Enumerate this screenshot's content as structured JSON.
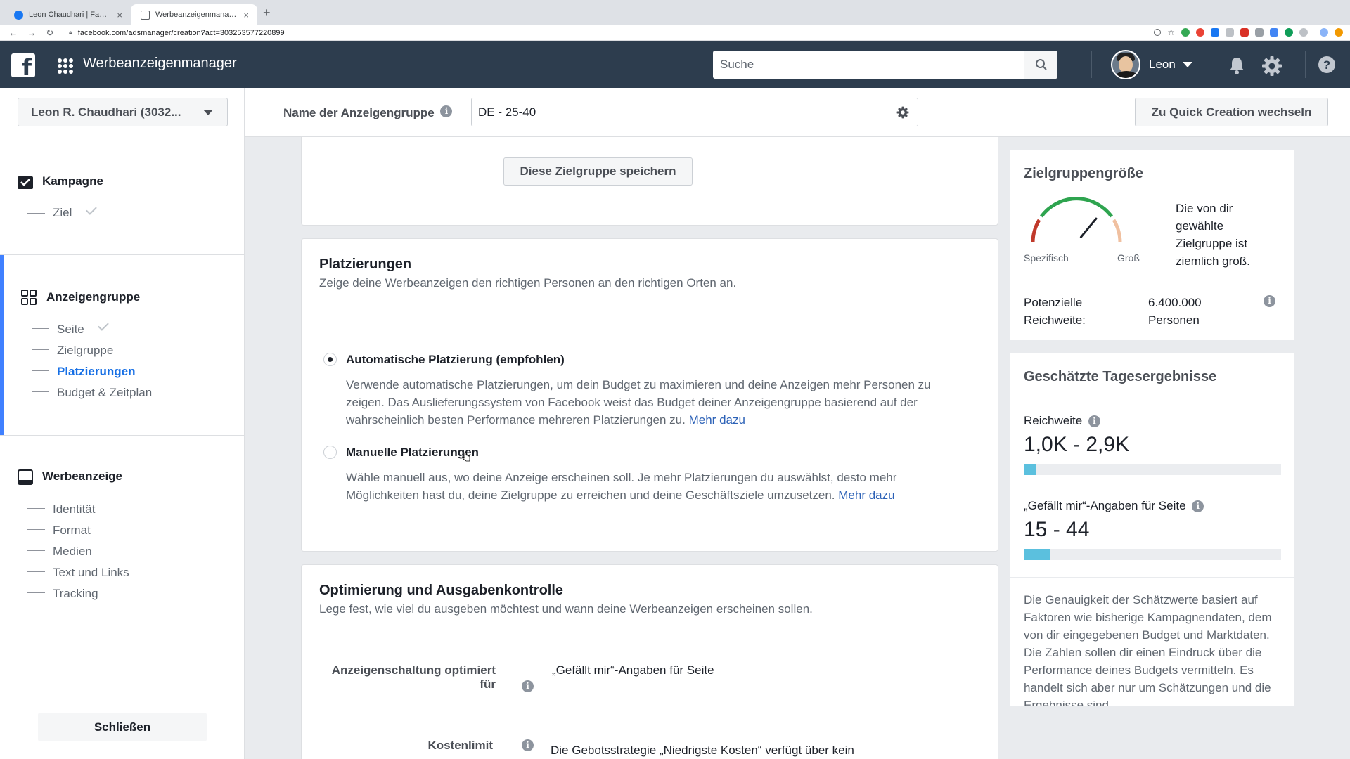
{
  "browser": {
    "tabs": [
      {
        "title": "Leon Chaudhari | Facebook",
        "active": false
      },
      {
        "title": "Werbeanzeigenmanager - Cre...",
        "active": true
      }
    ],
    "url": "facebook.com/adsmanager/creation?act=303253577220899"
  },
  "topbar": {
    "app_title": "Werbeanzeigenmanager",
    "search_placeholder": "Suche",
    "user_name": "Leon"
  },
  "header": {
    "account": "Leon R. Chaudhari (3032...",
    "adset_label": "Name der Anzeigengruppe",
    "adset_value": "DE - 25-40",
    "quick_btn": "Zu Quick Creation wechseln"
  },
  "sidebar": {
    "campaign": {
      "title": "Kampagne",
      "items": [
        "Ziel"
      ]
    },
    "adset": {
      "title": "Anzeigengruppe",
      "items": [
        "Seite",
        "Zielgruppe",
        "Platzierungen",
        "Budget & Zeitplan"
      ]
    },
    "ad": {
      "title": "Werbeanzeige",
      "items": [
        "Identität",
        "Format",
        "Medien",
        "Text und Links",
        "Tracking"
      ]
    },
    "close": "Schließen"
  },
  "audience_card": {
    "save_btn": "Diese Zielgruppe speichern"
  },
  "placements": {
    "title": "Platzierungen",
    "subtitle": "Zeige deine Werbeanzeigen den richtigen Personen an den richtigen Orten an.",
    "auto": {
      "label": "Automatische Platzierung (empfohlen)",
      "desc_l1": "Verwende automatische Platzierungen, um dein Budget zu maximieren und deine Anzeigen mehr Personen zu",
      "desc_l2": "zeigen. Das Auslieferungssystem von Facebook weist das Budget deiner Anzeigengruppe basierend auf der",
      "desc_l3": "wahrscheinlich besten Performance mehreren Platzierungen zu.",
      "link": "Mehr dazu",
      "selected": true
    },
    "manual": {
      "label": "Manuelle Platzierungen",
      "desc_l1": "Wähle manuell aus, wo deine Anzeige erscheinen soll. Je mehr Platzierungen du auswählst, desto mehr",
      "desc_l2": "Möglichkeiten hast du, deine Zielgruppe zu erreichen und deine Geschäftsziele umzusetzen.",
      "link": "Mehr dazu",
      "selected": false
    }
  },
  "optimization": {
    "title": "Optimierung und Ausgabenkontrolle",
    "subtitle": "Lege fest, wie viel du ausgeben möchtest und wann deine Werbeanzeigen erscheinen sollen.",
    "opt_label": "Anzeigenschaltung optimiert für",
    "opt_value": "„Gefällt mir“-Angaben für Seite",
    "cost_label": "Kostenlimit",
    "cost_value": "Die Gebotsstrategie „Niedrigste Kosten“ verfügt über kein"
  },
  "audience_size": {
    "title": "Zielgruppengröße",
    "specific": "Spezifisch",
    "broad": "Groß",
    "description": "Die von dir gewählte Zielgruppe ist ziemlich groß.",
    "reach_label_1": "Potenzielle",
    "reach_label_2": "Reichweite:",
    "reach_value_1": "6.400.000",
    "reach_value_2": "Personen",
    "needle_level": 0.72
  },
  "daily_results": {
    "title": "Geschätzte Tagesergebnisse",
    "reach_label": "Reichweite",
    "reach_value": "1,0K - 2,9K",
    "reach_fill": 0.05,
    "likes_label": "„Gefällt mir“-Angaben für Seite",
    "likes_value": "15 - 44",
    "likes_fill": 0.1,
    "disclaimer": "Die Genauigkeit der Schätzwerte basiert auf Faktoren wie bisherige Kampagnendaten, dem von dir eingegebenen Budget und Marktdaten. Die Zahlen sollen dir einen Eindruck über die Performance deines Budgets vermitteln. Es handelt sich aber nur um Schätzungen und die Ergebnisse sind"
  },
  "colors": {
    "topbar": "#2d3d4e",
    "accent": "#4080ff",
    "link": "#2d62b7",
    "bar_fill": "#5bc0de"
  }
}
